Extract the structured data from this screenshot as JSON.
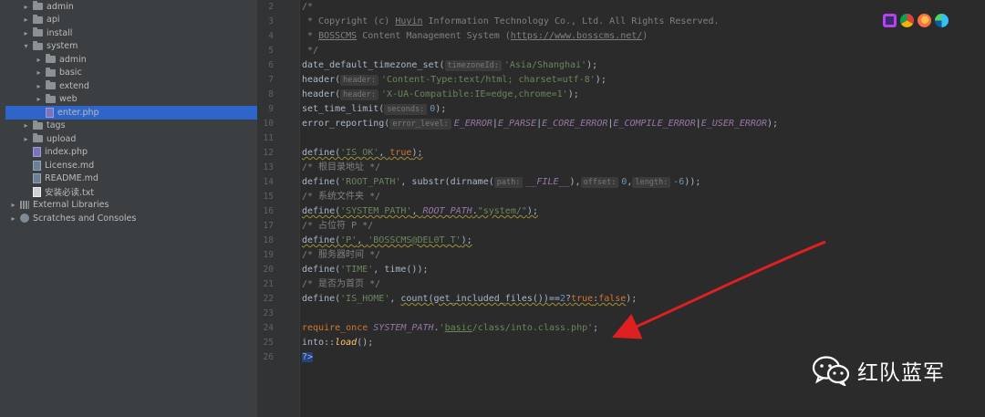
{
  "project_tree": [
    {
      "label": "admin",
      "kind": "folder",
      "depth": 1,
      "expanded": false
    },
    {
      "label": "api",
      "kind": "folder",
      "depth": 1,
      "expanded": false
    },
    {
      "label": "install",
      "kind": "folder",
      "depth": 1,
      "expanded": false
    },
    {
      "label": "system",
      "kind": "folder",
      "depth": 1,
      "expanded": true
    },
    {
      "label": "admin",
      "kind": "folder",
      "depth": 2,
      "expanded": false
    },
    {
      "label": "basic",
      "kind": "folder",
      "depth": 2,
      "expanded": false
    },
    {
      "label": "extend",
      "kind": "folder",
      "depth": 2,
      "expanded": false
    },
    {
      "label": "web",
      "kind": "folder",
      "depth": 2,
      "expanded": false
    },
    {
      "label": "enter.php",
      "kind": "php",
      "depth": 2,
      "selected": true
    },
    {
      "label": "tags",
      "kind": "folder",
      "depth": 1,
      "expanded": false
    },
    {
      "label": "upload",
      "kind": "folder",
      "depth": 1,
      "expanded": false
    },
    {
      "label": "index.php",
      "kind": "php",
      "depth": 1
    },
    {
      "label": "License.md",
      "kind": "md",
      "depth": 1
    },
    {
      "label": "README.md",
      "kind": "md",
      "depth": 1
    },
    {
      "label": "安装必读.txt",
      "kind": "txt",
      "depth": 1
    },
    {
      "label": "External Libraries",
      "kind": "lib",
      "depth": 0,
      "expanded": false
    },
    {
      "label": "Scratches and Consoles",
      "kind": "scratch",
      "depth": 0,
      "expanded": false
    }
  ],
  "line_numbers": [
    "2",
    "3",
    "4",
    "5",
    "6",
    "7",
    "8",
    "9",
    "10",
    "11",
    "12",
    "13",
    "14",
    "15",
    "16",
    "17",
    "18",
    "19",
    "20",
    "21",
    "22",
    "23",
    "24",
    "25",
    "26"
  ],
  "code": {
    "l2_open": "/*",
    "l3_a": " * Copyright (c) ",
    "l3_b": "Huyin",
    "l3_c": " Information Technology Co., Ltd. All Rights Reserved.",
    "l4_a": " * ",
    "l4_b": "BOSSCMS",
    "l4_c": " Content Management System (",
    "l4_d": "https://www.bosscms.net/",
    "l4_e": ")",
    "l5": " */",
    "l6_fn": "date_default_timezone_set(",
    "l6_hint": "timezoneId:",
    "l6_str": "'Asia/Shanghai'",
    "l6_end": ");",
    "l7_fn": "header(",
    "l7_hint": "header:",
    "l7_str": "'Content-Type:text/html; charset=utf-8'",
    "l7_end": ");",
    "l8_fn": "header(",
    "l8_hint": "header:",
    "l8_str": "'X-UA-Compatible:IE=edge,chrome=1'",
    "l8_end": ");",
    "l9_fn": "set_time_limit(",
    "l9_hint": "seconds:",
    "l9_num": "0",
    "l9_end": ");",
    "l10_fn": "error_reporting(",
    "l10_hint": "error_level:",
    "l10_c1": "E_ERROR",
    "l10_c2": "E_PARSE",
    "l10_c3": "E_CORE_ERROR",
    "l10_c4": "E_COMPILE_ERROR",
    "l10_c5": "E_USER_ERROR",
    "l10_pipe": "|",
    "l10_end": ");",
    "l12_fn": "define(",
    "l12_str": "'IS_OK'",
    "l12_comma": ", ",
    "l12_kw": "true",
    "l12_end": ");",
    "l13": "/* 根目录地址 */",
    "l14_fn": "define(",
    "l14_str": "'ROOT_PATH'",
    "l14_b": ", substr(dirname(",
    "l14_hint1": "path:",
    "l14_const": "__FILE__",
    "l14_c": "),",
    "l14_hint2": "offset:",
    "l14_num1": "0",
    "l14_d": ",",
    "l14_hint3": "length:",
    "l14_num2": "-6",
    "l14_end": "));",
    "l15": "/* 系统文件夹 */",
    "l16_fn": "define(",
    "l16_str": "'SYSTEM_PATH'",
    "l16_b": ", ",
    "l16_const": "ROOT_PATH",
    "l16_dot": ".",
    "l16_str2": "\"system/\"",
    "l16_end": ");",
    "l17": "/* 占位符 P */",
    "l18_fn": "define(",
    "l18_str": "'P'",
    "l18_b": ", ",
    "l18_str2": "'BOSSCMS@DEL0T_T'",
    "l18_end": ");",
    "l19": "/* 服务器时间 */",
    "l20_fn": "define(",
    "l20_str": "'TIME'",
    "l20_b": ", time());",
    "l21": "/* 是否为首页 */",
    "l22_fn": "define(",
    "l22_str": "'IS_HOME'",
    "l22_b": ", ",
    "l22_c": "count(get_included_files())==",
    "l22_num": "2",
    "l22_q": "?",
    "l22_kw1": "true",
    "l22_colon": ":",
    "l22_kw2": "false",
    "l22_end": ");",
    "l24_kw": "require_once",
    "l24_sp": " ",
    "l24_const": "SYSTEM_PATH",
    "l24_dot": ".",
    "l24_str_a": "'",
    "l24_str_b": "basic",
    "l24_str_c": "/class/into.class.php'",
    "l24_end": ";",
    "l25_a": "into::",
    "l25_b": "load",
    "l25_c": "();",
    "l26": "?>"
  },
  "watermark": {
    "text": "红队蓝军",
    "icon": "wechat-icon"
  },
  "browser_icons": [
    "phpstorm-icon",
    "chrome-icon",
    "firefox-icon",
    "edge-icon"
  ],
  "colors": {
    "accent_selection": "#2f65ca",
    "arrow": "#e02020",
    "string": "#6a8759",
    "keyword": "#cc7832",
    "constant": "#9876aa",
    "number": "#6897bb",
    "comment": "#808080"
  }
}
